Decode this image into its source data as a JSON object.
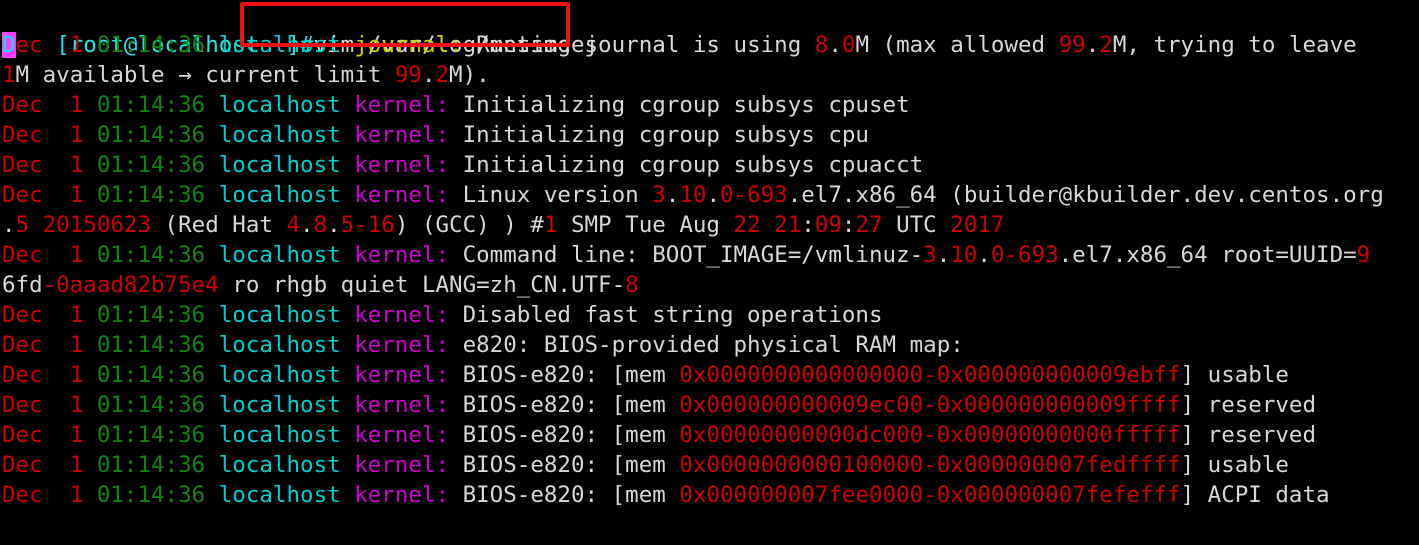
{
  "terminal": {
    "background_color": "#000000",
    "default_text_color": "#d8d8d8",
    "cursor": {
      "character": "D",
      "background_color": "#ff3fff",
      "foreground_color": "#00e5e5"
    },
    "annotation": {
      "type": "rectangle-highlight",
      "color": "#ee1111",
      "target": "vim /var/log/messages"
    },
    "prompt": {
      "bracket_open": "[",
      "user_host": "root@localhost",
      "path": " ~",
      "bracket_close": "]",
      "hash": "#",
      "command": "vim /var/log/messages",
      "prompt_color": "#22e5e5"
    },
    "log_lines": [
      {
        "id": "line-1",
        "segments": [
          {
            "text": "D",
            "style": "cursor"
          },
          {
            "text": "ec",
            "style": "red"
          },
          {
            "text": "  ",
            "style": "white"
          },
          {
            "text": "1",
            "style": "red"
          },
          {
            "text": " ",
            "style": "white"
          },
          {
            "text": "01:14:36",
            "style": "green"
          },
          {
            "text": " ",
            "style": "white"
          },
          {
            "text": "localhost",
            "style": "cyan"
          },
          {
            "text": " ",
            "style": "white"
          },
          {
            "text": "journal:",
            "style": "yellow"
          },
          {
            "text": " Runtime journal is using ",
            "style": "white"
          },
          {
            "text": "8",
            "style": "red"
          },
          {
            "text": ".",
            "style": "white"
          },
          {
            "text": "0",
            "style": "red"
          },
          {
            "text": "M (max allowed ",
            "style": "white"
          },
          {
            "text": "99",
            "style": "red"
          },
          {
            "text": ".",
            "style": "white"
          },
          {
            "text": "2",
            "style": "red"
          },
          {
            "text": "M, trying to leave ",
            "style": "white"
          }
        ]
      },
      {
        "id": "line-2-wrap",
        "segments": [
          {
            "text": "1",
            "style": "red"
          },
          {
            "text": "M available → current limit ",
            "style": "white"
          },
          {
            "text": "99",
            "style": "red"
          },
          {
            "text": ".",
            "style": "white"
          },
          {
            "text": "2",
            "style": "red"
          },
          {
            "text": "M).",
            "style": "white"
          }
        ]
      },
      {
        "id": "line-3",
        "segments": [
          {
            "text": "Dec",
            "style": "red"
          },
          {
            "text": "  ",
            "style": "white"
          },
          {
            "text": "1",
            "style": "red"
          },
          {
            "text": " ",
            "style": "white"
          },
          {
            "text": "01:14:36",
            "style": "green"
          },
          {
            "text": " ",
            "style": "white"
          },
          {
            "text": "localhost",
            "style": "cyan"
          },
          {
            "text": " ",
            "style": "white"
          },
          {
            "text": "kernel:",
            "style": "magenta"
          },
          {
            "text": " Initializing cgroup subsys cpuset",
            "style": "white"
          }
        ]
      },
      {
        "id": "line-4",
        "segments": [
          {
            "text": "Dec",
            "style": "red"
          },
          {
            "text": "  ",
            "style": "white"
          },
          {
            "text": "1",
            "style": "red"
          },
          {
            "text": " ",
            "style": "white"
          },
          {
            "text": "01:14:36",
            "style": "green"
          },
          {
            "text": " ",
            "style": "white"
          },
          {
            "text": "localhost",
            "style": "cyan"
          },
          {
            "text": " ",
            "style": "white"
          },
          {
            "text": "kernel:",
            "style": "magenta"
          },
          {
            "text": " Initializing cgroup subsys cpu",
            "style": "white"
          }
        ]
      },
      {
        "id": "line-5",
        "segments": [
          {
            "text": "Dec",
            "style": "red"
          },
          {
            "text": "  ",
            "style": "white"
          },
          {
            "text": "1",
            "style": "red"
          },
          {
            "text": " ",
            "style": "white"
          },
          {
            "text": "01:14:36",
            "style": "green"
          },
          {
            "text": " ",
            "style": "white"
          },
          {
            "text": "localhost",
            "style": "cyan"
          },
          {
            "text": " ",
            "style": "white"
          },
          {
            "text": "kernel:",
            "style": "magenta"
          },
          {
            "text": " Initializing cgroup subsys cpuacct",
            "style": "white"
          }
        ]
      },
      {
        "id": "line-6",
        "segments": [
          {
            "text": "Dec",
            "style": "red"
          },
          {
            "text": "  ",
            "style": "white"
          },
          {
            "text": "1",
            "style": "red"
          },
          {
            "text": " ",
            "style": "white"
          },
          {
            "text": "01:14:36",
            "style": "green"
          },
          {
            "text": " ",
            "style": "white"
          },
          {
            "text": "localhost",
            "style": "cyan"
          },
          {
            "text": " ",
            "style": "white"
          },
          {
            "text": "kernel:",
            "style": "magenta"
          },
          {
            "text": " Linux version ",
            "style": "white"
          },
          {
            "text": "3",
            "style": "red"
          },
          {
            "text": ".",
            "style": "white"
          },
          {
            "text": "10",
            "style": "red"
          },
          {
            "text": ".",
            "style": "white"
          },
          {
            "text": "0-693",
            "style": "red"
          },
          {
            "text": ".el7.x86_64 (builder@kbuilder.dev.centos.org",
            "style": "white"
          }
        ]
      },
      {
        "id": "line-7-wrap",
        "segments": [
          {
            "text": ".",
            "style": "white"
          },
          {
            "text": "5 20150623",
            "style": "red"
          },
          {
            "text": " (Red Hat ",
            "style": "white"
          },
          {
            "text": "4",
            "style": "red"
          },
          {
            "text": ".",
            "style": "white"
          },
          {
            "text": "8",
            "style": "red"
          },
          {
            "text": ".",
            "style": "white"
          },
          {
            "text": "5-16",
            "style": "red"
          },
          {
            "text": ") (GCC) ) #",
            "style": "white"
          },
          {
            "text": "1",
            "style": "red"
          },
          {
            "text": " SMP Tue Aug ",
            "style": "white"
          },
          {
            "text": "22",
            "style": "red"
          },
          {
            "text": " ",
            "style": "white"
          },
          {
            "text": "21",
            "style": "red"
          },
          {
            "text": ":",
            "style": "white"
          },
          {
            "text": "09",
            "style": "red"
          },
          {
            "text": ":",
            "style": "white"
          },
          {
            "text": "27",
            "style": "red"
          },
          {
            "text": " UTC ",
            "style": "white"
          },
          {
            "text": "2017",
            "style": "red"
          }
        ]
      },
      {
        "id": "line-8",
        "segments": [
          {
            "text": "Dec",
            "style": "red"
          },
          {
            "text": "  ",
            "style": "white"
          },
          {
            "text": "1",
            "style": "red"
          },
          {
            "text": " ",
            "style": "white"
          },
          {
            "text": "01:14:36",
            "style": "green"
          },
          {
            "text": " ",
            "style": "white"
          },
          {
            "text": "localhost",
            "style": "cyan"
          },
          {
            "text": " ",
            "style": "white"
          },
          {
            "text": "kernel:",
            "style": "magenta"
          },
          {
            "text": " Command line: BOOT_IMAGE=/vmlinuz-",
            "style": "white"
          },
          {
            "text": "3",
            "style": "red"
          },
          {
            "text": ".",
            "style": "white"
          },
          {
            "text": "10",
            "style": "red"
          },
          {
            "text": ".",
            "style": "white"
          },
          {
            "text": "0-693",
            "style": "red"
          },
          {
            "text": ".el7.x86_64 root=UUID=",
            "style": "white"
          },
          {
            "text": "9",
            "style": "red"
          }
        ]
      },
      {
        "id": "line-9-wrap",
        "segments": [
          {
            "text": "6fd",
            "style": "white"
          },
          {
            "text": "-0aaad82b75e4",
            "style": "red"
          },
          {
            "text": " ro rhgb quiet LANG=zh_CN.UTF-",
            "style": "white"
          },
          {
            "text": "8",
            "style": "red"
          }
        ]
      },
      {
        "id": "line-10",
        "segments": [
          {
            "text": "Dec",
            "style": "red"
          },
          {
            "text": "  ",
            "style": "white"
          },
          {
            "text": "1",
            "style": "red"
          },
          {
            "text": " ",
            "style": "white"
          },
          {
            "text": "01:14:36",
            "style": "green"
          },
          {
            "text": " ",
            "style": "white"
          },
          {
            "text": "localhost",
            "style": "cyan"
          },
          {
            "text": " ",
            "style": "white"
          },
          {
            "text": "kernel:",
            "style": "magenta"
          },
          {
            "text": " Disabled fast string operations",
            "style": "white"
          }
        ]
      },
      {
        "id": "line-11",
        "segments": [
          {
            "text": "Dec",
            "style": "red"
          },
          {
            "text": "  ",
            "style": "white"
          },
          {
            "text": "1",
            "style": "red"
          },
          {
            "text": " ",
            "style": "white"
          },
          {
            "text": "01:14:36",
            "style": "green"
          },
          {
            "text": " ",
            "style": "white"
          },
          {
            "text": "localhost",
            "style": "cyan"
          },
          {
            "text": " ",
            "style": "white"
          },
          {
            "text": "kernel:",
            "style": "magenta"
          },
          {
            "text": " e820: BIOS-provided physical RAM map:",
            "style": "white"
          }
        ]
      },
      {
        "id": "line-12",
        "segments": [
          {
            "text": "Dec",
            "style": "red"
          },
          {
            "text": "  ",
            "style": "white"
          },
          {
            "text": "1",
            "style": "red"
          },
          {
            "text": " ",
            "style": "white"
          },
          {
            "text": "01:14:36",
            "style": "green"
          },
          {
            "text": " ",
            "style": "white"
          },
          {
            "text": "localhost",
            "style": "cyan"
          },
          {
            "text": " ",
            "style": "white"
          },
          {
            "text": "kernel:",
            "style": "magenta"
          },
          {
            "text": " BIOS-e820: [mem ",
            "style": "white"
          },
          {
            "text": "0x0000000000000000-0x000000000009ebff",
            "style": "red"
          },
          {
            "text": "] usable",
            "style": "white"
          }
        ]
      },
      {
        "id": "line-13",
        "segments": [
          {
            "text": "Dec",
            "style": "red"
          },
          {
            "text": "  ",
            "style": "white"
          },
          {
            "text": "1",
            "style": "red"
          },
          {
            "text": " ",
            "style": "white"
          },
          {
            "text": "01:14:36",
            "style": "green"
          },
          {
            "text": " ",
            "style": "white"
          },
          {
            "text": "localhost",
            "style": "cyan"
          },
          {
            "text": " ",
            "style": "white"
          },
          {
            "text": "kernel:",
            "style": "magenta"
          },
          {
            "text": " BIOS-e820: [mem ",
            "style": "white"
          },
          {
            "text": "0x000000000009ec00-0x000000000009ffff",
            "style": "red"
          },
          {
            "text": "] reserved",
            "style": "white"
          }
        ]
      },
      {
        "id": "line-14",
        "segments": [
          {
            "text": "Dec",
            "style": "red"
          },
          {
            "text": "  ",
            "style": "white"
          },
          {
            "text": "1",
            "style": "red"
          },
          {
            "text": " ",
            "style": "white"
          },
          {
            "text": "01:14:36",
            "style": "green"
          },
          {
            "text": " ",
            "style": "white"
          },
          {
            "text": "localhost",
            "style": "cyan"
          },
          {
            "text": " ",
            "style": "white"
          },
          {
            "text": "kernel:",
            "style": "magenta"
          },
          {
            "text": " BIOS-e820: [mem ",
            "style": "white"
          },
          {
            "text": "0x00000000000dc000-0x00000000000fffff",
            "style": "red"
          },
          {
            "text": "] reserved",
            "style": "white"
          }
        ]
      },
      {
        "id": "line-15",
        "segments": [
          {
            "text": "Dec",
            "style": "red"
          },
          {
            "text": "  ",
            "style": "white"
          },
          {
            "text": "1",
            "style": "red"
          },
          {
            "text": " ",
            "style": "white"
          },
          {
            "text": "01:14:36",
            "style": "green"
          },
          {
            "text": " ",
            "style": "white"
          },
          {
            "text": "localhost",
            "style": "cyan"
          },
          {
            "text": " ",
            "style": "white"
          },
          {
            "text": "kernel:",
            "style": "magenta"
          },
          {
            "text": " BIOS-e820: [mem ",
            "style": "white"
          },
          {
            "text": "0x0000000000100000-0x000000007fedffff",
            "style": "red"
          },
          {
            "text": "] usable",
            "style": "white"
          }
        ]
      },
      {
        "id": "line-16",
        "segments": [
          {
            "text": "Dec",
            "style": "red"
          },
          {
            "text": "  ",
            "style": "white"
          },
          {
            "text": "1",
            "style": "red"
          },
          {
            "text": " ",
            "style": "white"
          },
          {
            "text": "01:14:36",
            "style": "green"
          },
          {
            "text": " ",
            "style": "white"
          },
          {
            "text": "localhost",
            "style": "cyan"
          },
          {
            "text": " ",
            "style": "white"
          },
          {
            "text": "kernel:",
            "style": "magenta"
          },
          {
            "text": " BIOS-e820: [mem ",
            "style": "white"
          },
          {
            "text": "0x000000007fee0000-0x000000007fefefff",
            "style": "red"
          },
          {
            "text": "] ACPI data",
            "style": "white"
          }
        ]
      }
    ]
  }
}
